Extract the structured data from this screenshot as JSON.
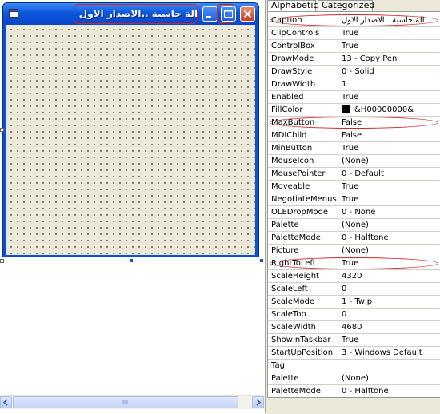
{
  "form": {
    "caption": "الة حاسبة ..الاصدار الاول",
    "buttons": {
      "minimize": "minimize",
      "maximize": "maximize",
      "close": "close"
    }
  },
  "tabs": [
    {
      "label": "Alphabetic",
      "selected": true
    },
    {
      "label": "Categorized",
      "selected": false
    }
  ],
  "properties": [
    {
      "name": "Caption",
      "value": "الة حاسبة ..الاصدار الاول",
      "highlighted": true
    },
    {
      "name": "ClipControls",
      "value": "True"
    },
    {
      "name": "ControlBox",
      "value": "True"
    },
    {
      "name": "DrawMode",
      "value": "13 - Copy Pen"
    },
    {
      "name": "DrawStyle",
      "value": "0 - Solid"
    },
    {
      "name": "DrawWidth",
      "value": "1"
    },
    {
      "name": "Enabled",
      "value": "True"
    },
    {
      "name": "FillColor",
      "value": "&H00000000&",
      "swatch": "#000000"
    },
    {
      "name": "MaxButton",
      "value": "False",
      "highlighted": true
    },
    {
      "name": "MDIChild",
      "value": "False"
    },
    {
      "name": "MinButton",
      "value": "True"
    },
    {
      "name": "MouseIcon",
      "value": "(None)"
    },
    {
      "name": "MousePointer",
      "value": "0 - Default"
    },
    {
      "name": "Moveable",
      "value": "True"
    },
    {
      "name": "NegotiateMenus",
      "value": "True"
    },
    {
      "name": "OLEDropMode",
      "value": "0 - None"
    },
    {
      "name": "Palette",
      "value": "(None)"
    },
    {
      "name": "PaletteMode",
      "value": "0 - Halftone"
    },
    {
      "name": "Picture",
      "value": "(None)"
    },
    {
      "name": "RightToLeft",
      "value": "True",
      "highlighted": true
    },
    {
      "name": "ScaleHeight",
      "value": "4320"
    },
    {
      "name": "ScaleLeft",
      "value": "0"
    },
    {
      "name": "ScaleMode",
      "value": "1 - Twip"
    },
    {
      "name": "ScaleTop",
      "value": "0"
    },
    {
      "name": "ScaleWidth",
      "value": "4680"
    },
    {
      "name": "ShowInTaskbar",
      "value": "True"
    },
    {
      "name": "StartUpPosition",
      "value": "3 - Windows Default"
    },
    {
      "name": "Tag",
      "value": ""
    },
    {
      "name": "Palette",
      "value": "(None)"
    },
    {
      "name": "PaletteMode",
      "value": "0 - Halftone"
    }
  ],
  "colors": {
    "titlebar": "#0a4fd8",
    "highlight": "#d0262c",
    "panel": "#ece9d8"
  }
}
